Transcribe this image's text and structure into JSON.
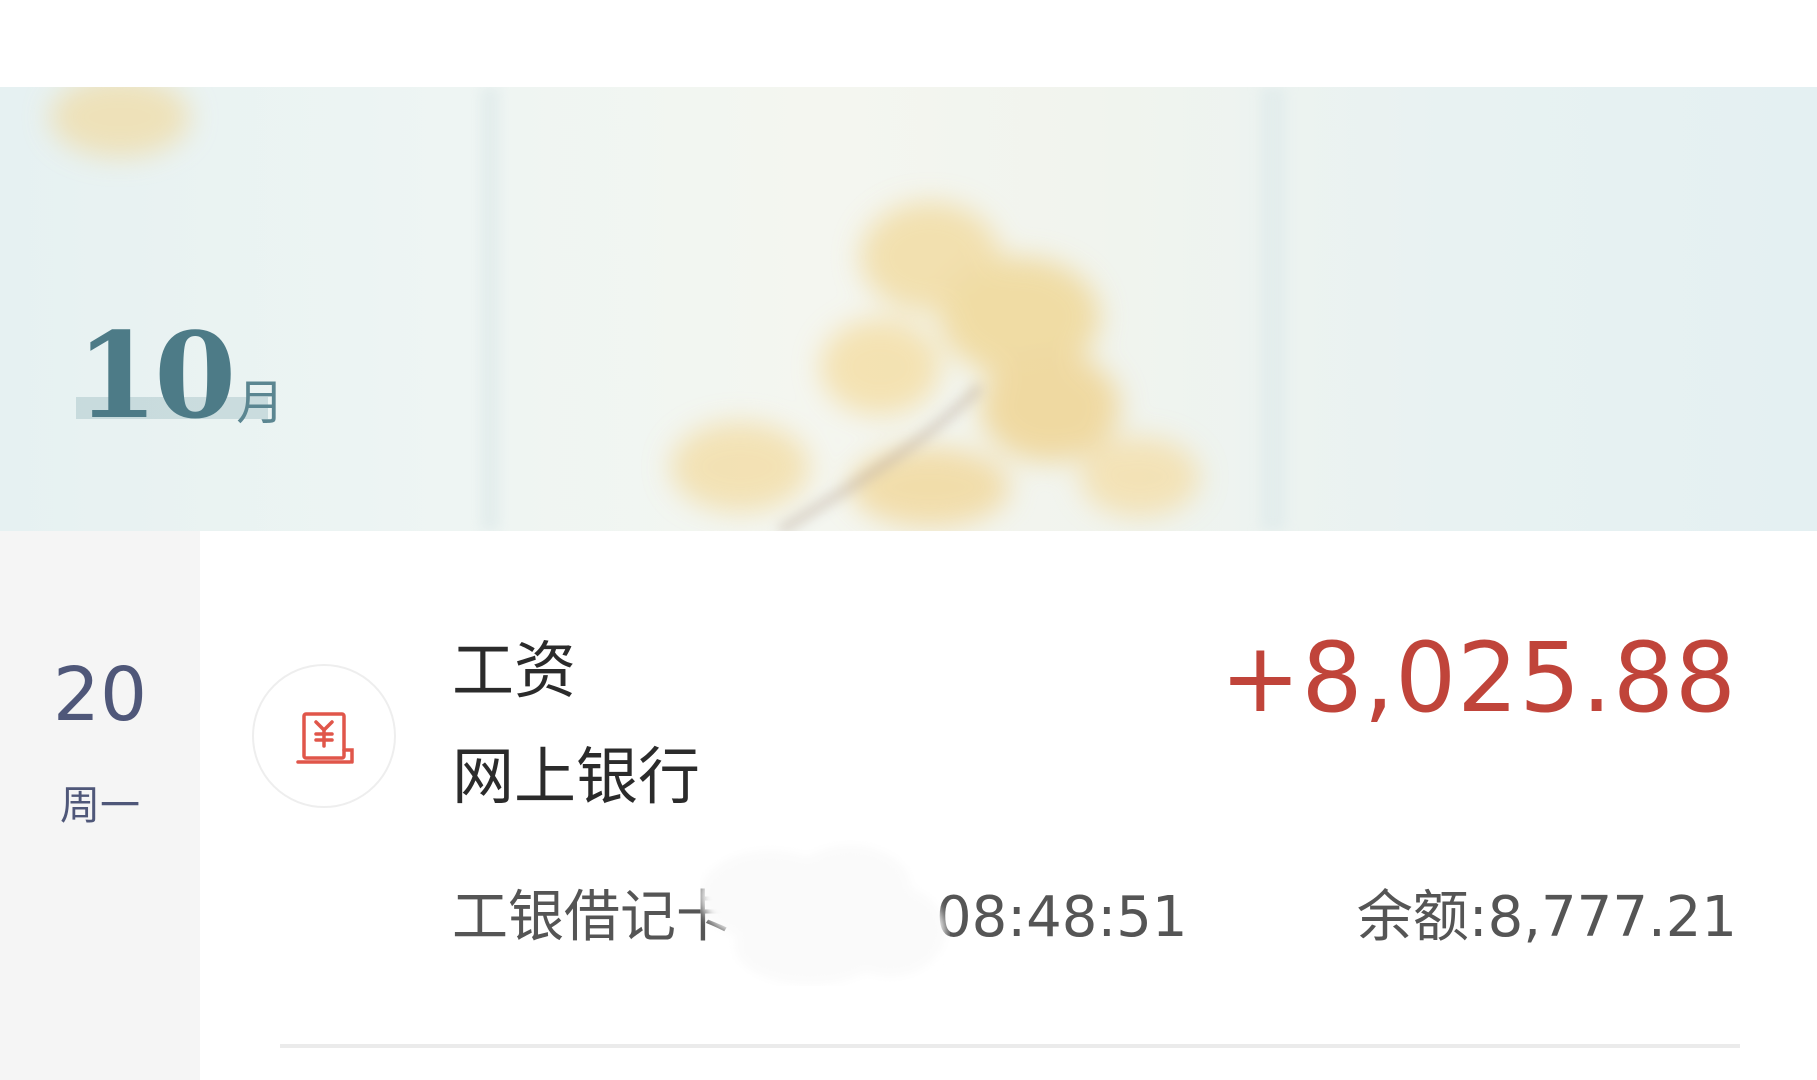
{
  "banner": {
    "month_number": "10",
    "month_unit": "月"
  },
  "date": {
    "day": "20",
    "weekday": "周一"
  },
  "transaction": {
    "icon": "salary-document-icon",
    "title": "工资",
    "channel": "网上银行",
    "amount": "+8,025.88",
    "account_prefix": "工银借记卡",
    "time_suffix": "08:48:51",
    "balance_label": "余额: ",
    "balance_value": "8,777.21"
  },
  "colors": {
    "amount_income": "#c0443a",
    "date_text": "#4f5779",
    "month_accent": "#4d7b87",
    "icon_red": "#e0564a"
  }
}
